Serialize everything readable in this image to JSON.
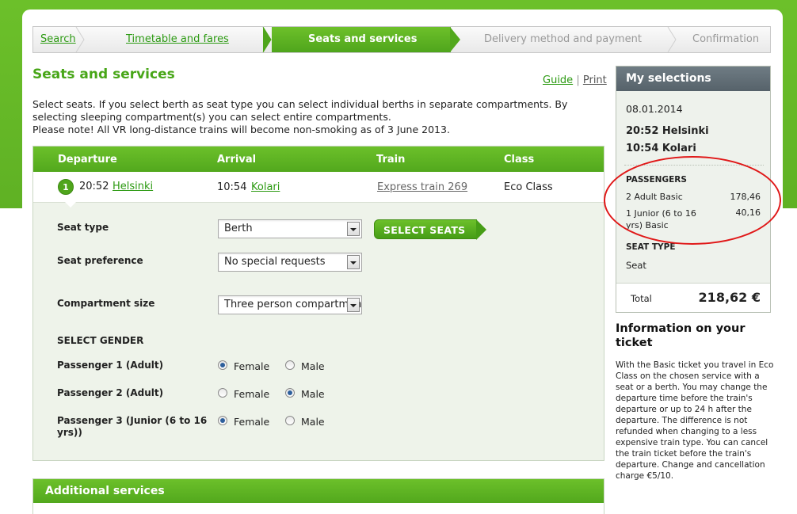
{
  "steps": [
    {
      "label": "Search",
      "state": "link"
    },
    {
      "label": "Timetable and fares",
      "state": "link"
    },
    {
      "label": "Seats and services",
      "state": "active"
    },
    {
      "label": "Delivery method and payment",
      "state": "upcoming"
    },
    {
      "label": "Confirmation",
      "state": "upcoming"
    }
  ],
  "page_title": "Seats and services",
  "links": {
    "guide": "Guide",
    "separator": "|",
    "print": "Print"
  },
  "intro": {
    "line1": "Select seats. If you select berth as seat type you can select individual berths in separate compartments. By selecting sleeping compartment(s) you can select entire compartments.",
    "line2": "Please note! All VR long-distance trains will become non-smoking as of 3 June 2013."
  },
  "journey": {
    "headers": {
      "departure": "Departure",
      "arrival": "Arrival",
      "train": "Train",
      "class": "Class"
    },
    "row": {
      "number": "1",
      "dep_time": "20:52",
      "dep_station": "Helsinki",
      "arr_time": "10:54",
      "arr_station": "Kolari",
      "train": "Express train 269",
      "class": "Eco Class"
    }
  },
  "form": {
    "seat_type_label": "Seat type",
    "seat_type_value": "Berth",
    "select_seats_button": "SELECT SEATS",
    "seat_pref_label": "Seat preference",
    "seat_pref_value": "No special requests",
    "compartment_label": "Compartment size",
    "compartment_value": "Three person compartment",
    "gender_heading": "SELECT GENDER",
    "female": "Female",
    "male": "Male",
    "passengers": [
      {
        "label": "Passenger 1  (Adult)",
        "selected": "female"
      },
      {
        "label": "Passenger 2  (Adult)",
        "selected": "male"
      },
      {
        "label": "Passenger 3  (Junior (6 to 16 yrs))",
        "selected": "female"
      }
    ]
  },
  "additional_services": "Additional services",
  "my_selections": {
    "title": "My selections",
    "date": "08.01.2014",
    "dep": "20:52 Helsinki",
    "arr": "10:54 Kolari",
    "passengers_heading": "PASSENGERS",
    "passenger_lines": [
      {
        "label": "2 Adult Basic",
        "price": "178,46"
      },
      {
        "label": "1 Junior (6 to 16 yrs) Basic",
        "price": "40,16"
      }
    ],
    "seat_type_heading": "SEAT TYPE",
    "seat_type_value": "Seat",
    "total_label": "Total",
    "total_value": "218,62 €"
  },
  "info": {
    "title": "Information on your ticket",
    "text": "With the Basic ticket you travel in Eco Class on the chosen service with a seat or a berth. You may change the departure time before the train's departure or up to 24 h after the departure. The difference is not refunded when changing to a less expensive train type. You can cancel the train ticket before the train's departure. Change and cancellation charge €5/10."
  },
  "colors": {
    "brand_green": "#5fb124",
    "link_green": "#2c9a12",
    "annotation_red": "#e01818",
    "panel_head": "#56626a"
  }
}
